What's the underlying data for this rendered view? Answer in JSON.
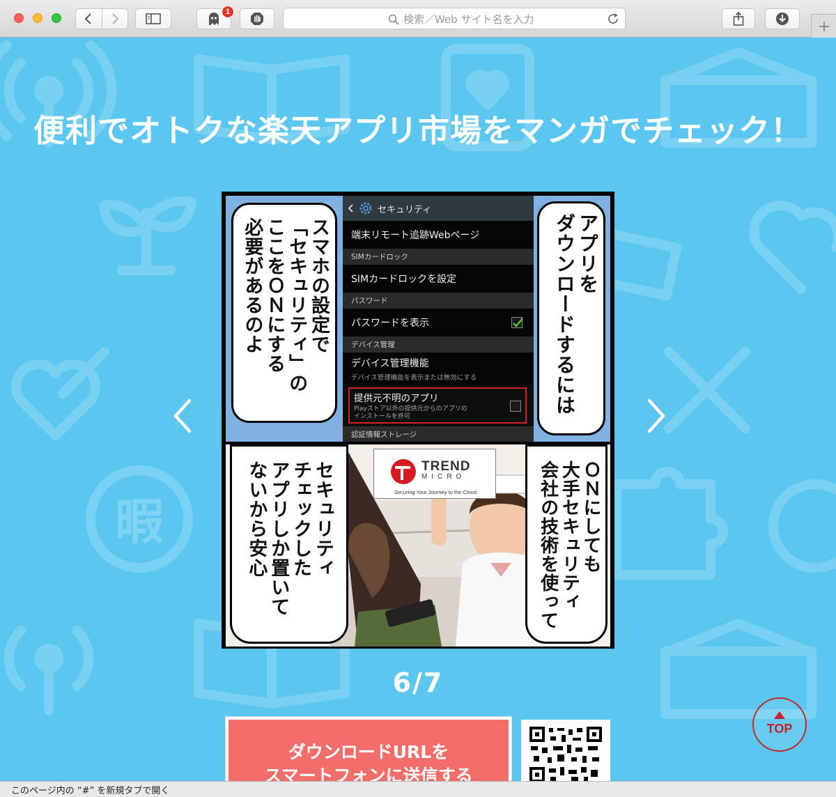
{
  "browser": {
    "address_placeholder": "検索／Web サイト名を入力",
    "extension_badge_count": "1",
    "icons": {
      "back": "chevron-left-icon",
      "forward": "chevron-right-icon",
      "sidebar": "sidebar-icon",
      "ghostery": "ghost-icon",
      "adblock": "hand-stop-icon",
      "search": "search-icon",
      "reload": "reload-icon",
      "share": "share-icon",
      "downloads": "download-icon",
      "new_tab": "plus-icon"
    },
    "status_text": "このページ内の “#” を新規タブで開く"
  },
  "page": {
    "headline": "便利でオトクな楽天アプリ市場をマンガでチェック！",
    "counter": "6/7",
    "background_color": "#5bc6ef",
    "download_button": {
      "line1": "ダウンロードURLを",
      "line2": "スマートフォンに送信する"
    },
    "top_button_label": "TOP",
    "accent_red": "#c3252a"
  },
  "manga": {
    "top_panel": {
      "left_bubble": "スマホの設定で\n「セキュリティ」の\nここをＯＮにする\n必要があるのよ",
      "right_bubble": "アプリを\nダウンロードするには",
      "phone": {
        "header": "セキュリティ",
        "rows": [
          {
            "type": "row",
            "label": "端末リモート追跡Webページ"
          },
          {
            "type": "section",
            "label": "SIMカードロック"
          },
          {
            "type": "row",
            "label": "SIMカードロックを設定"
          },
          {
            "type": "section",
            "label": "パスワード"
          },
          {
            "type": "row",
            "label": "パスワードを表示",
            "checked": true
          },
          {
            "type": "section",
            "label": "デバイス管理"
          },
          {
            "type": "tall",
            "label": "デバイス管理機能",
            "sub": "デバイス管理機能を表示または無効にする"
          }
        ],
        "highlight": {
          "label": "提供元不明のアプリ",
          "sub1": "Playストア以外の提供元からのアプリの",
          "sub2": "インストールを許可",
          "checked": false
        },
        "footer_section": "認証情報ストレージ"
      }
    },
    "bottom_panel": {
      "left_bubble": "セキュリティ\nチェックした\nアプリしか置いて\nないから安心",
      "right_bubble": "ＯＮにしても\n大手セキュリティ\n会社の技術を使って",
      "logo": {
        "name": "TREND",
        "sub": "MICRO",
        "tagline": "Securing Your Journey to the Cloud"
      }
    }
  }
}
